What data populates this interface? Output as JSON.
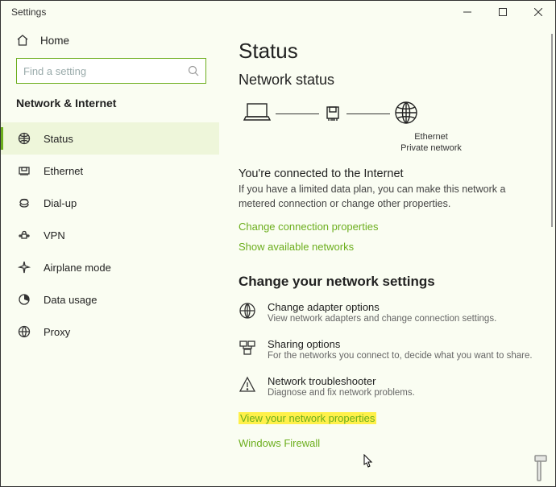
{
  "window": {
    "title": "Settings"
  },
  "sidebar": {
    "home": "Home",
    "search_placeholder": "Find a setting",
    "category": "Network & Internet",
    "items": [
      {
        "label": "Status"
      },
      {
        "label": "Ethernet"
      },
      {
        "label": "Dial-up"
      },
      {
        "label": "VPN"
      },
      {
        "label": "Airplane mode"
      },
      {
        "label": "Data usage"
      },
      {
        "label": "Proxy"
      }
    ]
  },
  "main": {
    "title": "Status",
    "subtitle": "Network status",
    "diagram": {
      "adapter": "Ethernet",
      "network_type": "Private network"
    },
    "connected_heading": "You're connected to the Internet",
    "connected_body": "If you have a limited data plan, you can make this network a metered connection or change other properties.",
    "link_change_props": "Change connection properties",
    "link_show_networks": "Show available networks",
    "change_settings_heading": "Change your network settings",
    "rows": [
      {
        "title": "Change adapter options",
        "desc": "View network adapters and change connection settings."
      },
      {
        "title": "Sharing options",
        "desc": "For the networks you connect to, decide what you want to share."
      },
      {
        "title": "Network troubleshooter",
        "desc": "Diagnose and fix network problems."
      }
    ],
    "link_view_props": "View your network properties",
    "link_firewall": "Windows Firewall"
  }
}
